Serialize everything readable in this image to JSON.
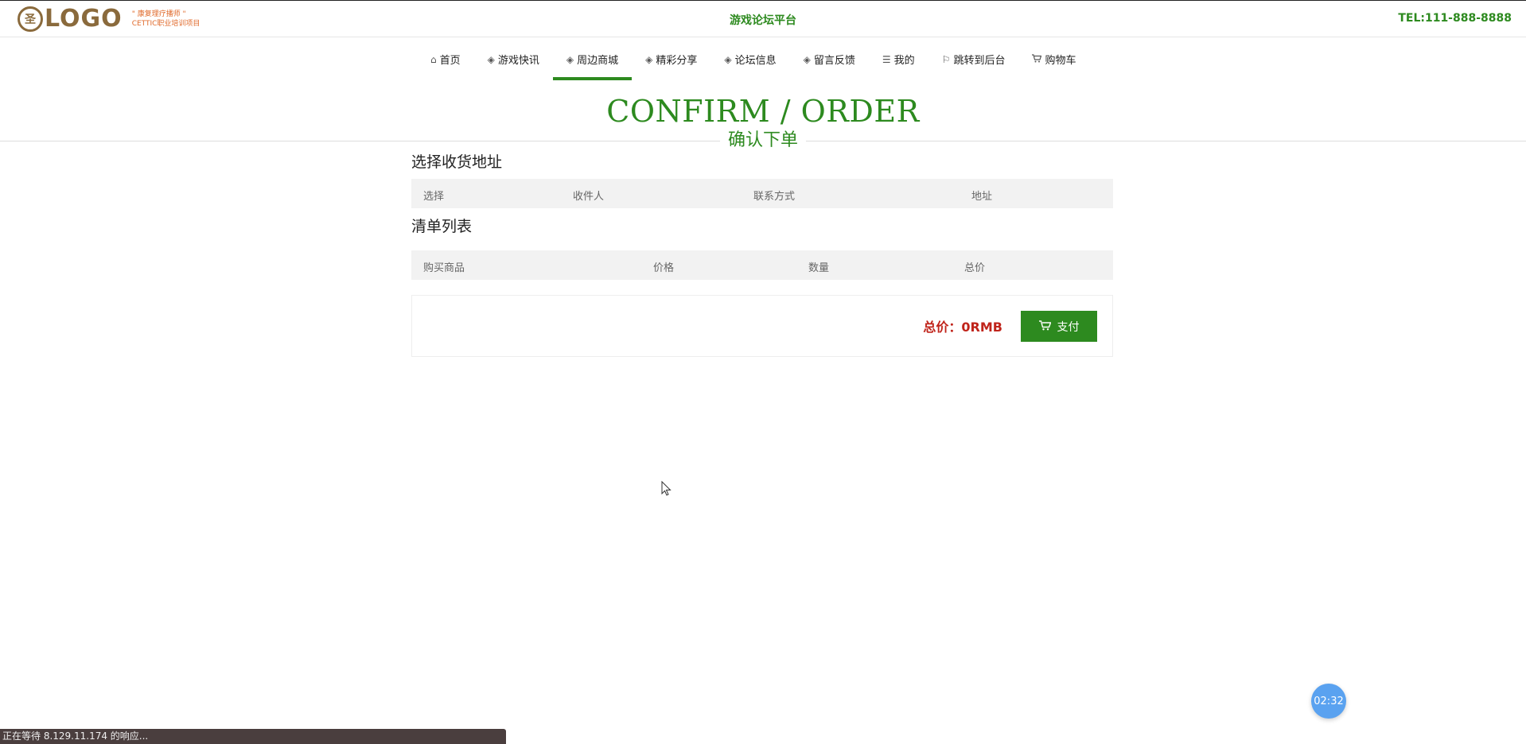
{
  "header": {
    "logo_mark": "圣",
    "logo_text": "LOGO",
    "logo_sub_line1": "\" 康复理疗播师 \"",
    "logo_sub_line2": "CETTIC职业培训项目",
    "site_title": "游戏论坛平台",
    "tel": "TEL:111-888-8888"
  },
  "nav": {
    "items": [
      {
        "label": "首页",
        "icon": "home-icon",
        "glyph": "⌂"
      },
      {
        "label": "游戏快讯",
        "icon": "layers-icon",
        "glyph": "◈"
      },
      {
        "label": "周边商城",
        "icon": "layers-icon",
        "glyph": "◈",
        "active": true
      },
      {
        "label": "精彩分享",
        "icon": "layers-icon",
        "glyph": "◈"
      },
      {
        "label": "论坛信息",
        "icon": "layers-icon",
        "glyph": "◈"
      },
      {
        "label": "留言反馈",
        "icon": "layers-icon",
        "glyph": "◈"
      },
      {
        "label": "我的",
        "icon": "menu-icon",
        "glyph": "☰"
      },
      {
        "label": "跳转到后台",
        "icon": "flag-icon",
        "glyph": "⚐"
      },
      {
        "label": "购物车",
        "icon": "cart-icon",
        "glyph": "🛒"
      }
    ]
  },
  "page": {
    "title_en": "CONFIRM / ORDER",
    "title_zh": "确认下单"
  },
  "address": {
    "title": "选择收货地址",
    "columns": [
      "选择",
      "收件人",
      "联系方式",
      "地址"
    ]
  },
  "items": {
    "title": "清单列表",
    "columns": [
      "购买商品",
      "价格",
      "数量",
      "总价"
    ]
  },
  "summary": {
    "total_label": "总价：0RMB",
    "pay_label": "支付"
  },
  "timer": "02:32",
  "status_bar": "正在等待 8.129.11.174 的响应...",
  "colors": {
    "accent": "#2d8a1f",
    "total": "#c0241b",
    "logo": "#8a6a3c"
  }
}
